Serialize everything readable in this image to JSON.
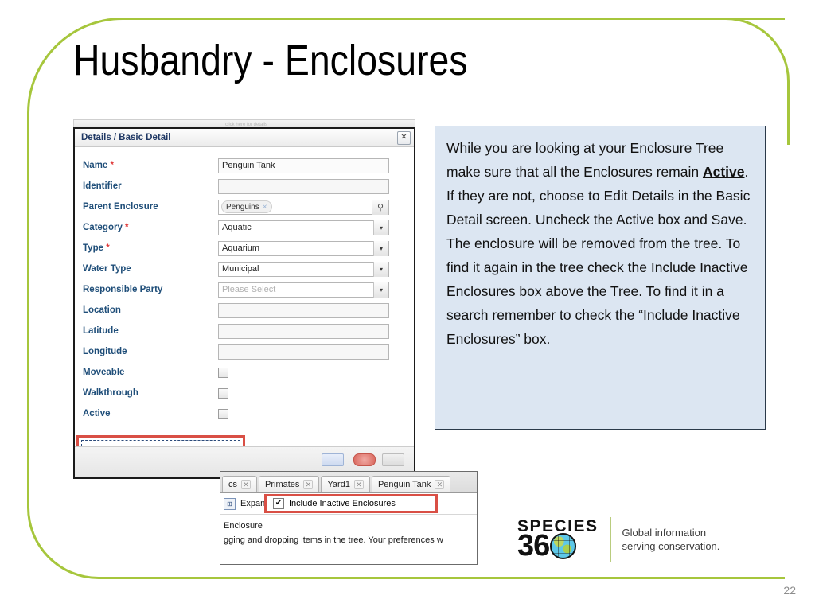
{
  "slide": {
    "title": "Husbandry - Enclosures",
    "page_number": "22",
    "accent_green": "#a6c63c",
    "highlight_red": "#d94f45"
  },
  "dialog": {
    "ghost_text": "click here for details",
    "title": "Details / Basic Detail",
    "close_icon": "✕",
    "rows": [
      {
        "label": "Name",
        "required": true,
        "kind": "text",
        "value": "Penguin Tank"
      },
      {
        "label": "Identifier",
        "required": false,
        "kind": "text",
        "value": ""
      },
      {
        "label": "Parent Enclosure",
        "required": false,
        "kind": "lookup",
        "value": "Penguins"
      },
      {
        "label": "Category",
        "required": true,
        "kind": "select",
        "value": "Aquatic"
      },
      {
        "label": "Type",
        "required": true,
        "kind": "select",
        "value": "Aquarium"
      },
      {
        "label": "Water Type",
        "required": false,
        "kind": "select",
        "value": "Municipal"
      },
      {
        "label": "Responsible Party",
        "required": false,
        "kind": "select",
        "value": "Please Select"
      },
      {
        "label": "Location",
        "required": false,
        "kind": "text",
        "value": ""
      },
      {
        "label": "Latitude",
        "required": false,
        "kind": "text",
        "value": ""
      },
      {
        "label": "Longitude",
        "required": false,
        "kind": "text",
        "value": ""
      },
      {
        "label": "Moveable",
        "required": false,
        "kind": "checkbox",
        "checked": false
      },
      {
        "label": "Walkthrough",
        "required": false,
        "kind": "checkbox",
        "checked": false
      },
      {
        "label": "Active",
        "required": false,
        "kind": "checkbox",
        "checked": false
      }
    ],
    "required_marker": "*",
    "tag_remove_icon": "×",
    "search_icon": "⚲",
    "select_arrow_icon": "▾"
  },
  "overlay": {
    "tabs": [
      {
        "label": "cs",
        "close": "✕"
      },
      {
        "label": "Primates",
        "close": "✕"
      },
      {
        "label": "Yard1",
        "close": "✕"
      },
      {
        "label": "Penguin Tank",
        "close": "✕"
      }
    ],
    "expand_all_label": "Expand All",
    "expand_icon": "⊞",
    "flag_icon": "⚑",
    "include_inactive_label": "Include Inactive Enclosures",
    "include_inactive_checked": true,
    "check_glyph": "✔",
    "line1": "Enclosure",
    "line2": "gging and dropping items in the tree. Your preferences w"
  },
  "info": {
    "text_before": "While you are looking at your Enclosure Tree make sure that all the Enclosures remain ",
    "emphasis": "Active",
    "text_after": ". If they are not, choose to Edit Details in the Basic Detail screen. Uncheck the Active box and Save. The enclosure will be removed from the tree. To find it again in the tree check the Include Inactive Enclosures box above the Tree. To find it in a search remember to check the “Include Inactive Enclosures” box."
  },
  "logo": {
    "species": "SPECIES",
    "number": "36",
    "tagline_line1": "Global information",
    "tagline_line2": "serving conservation."
  }
}
